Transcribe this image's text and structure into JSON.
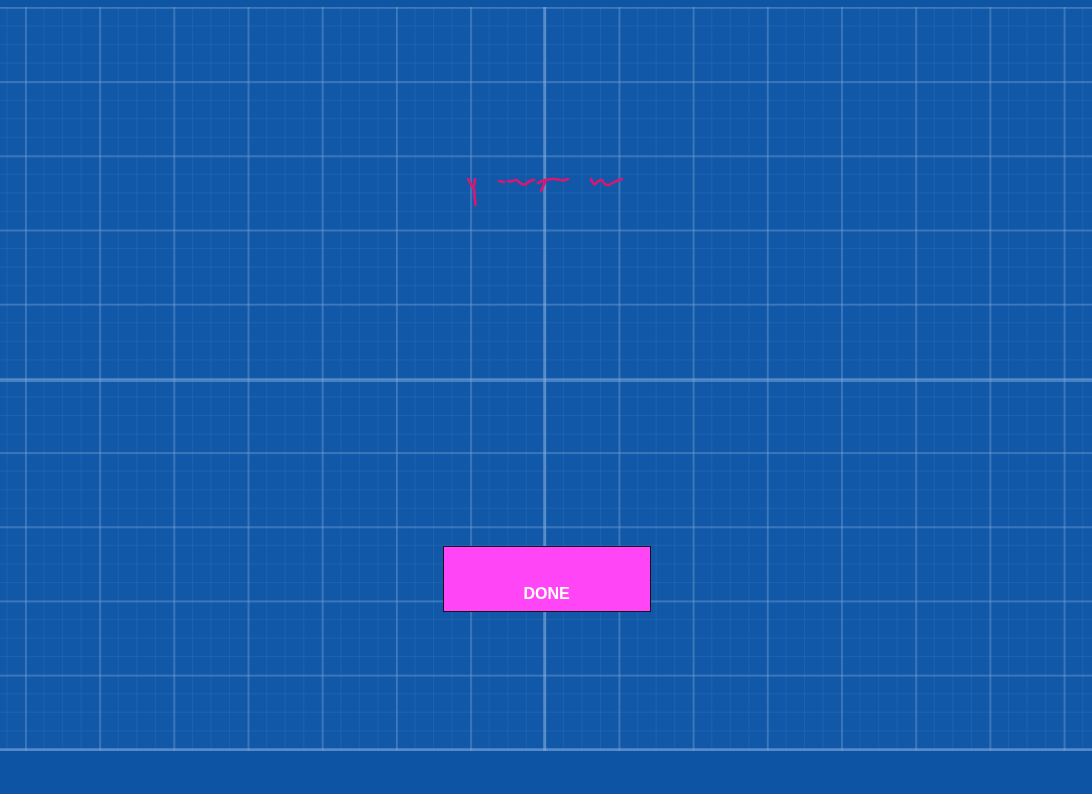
{
  "done_button": {
    "label": "DONE"
  }
}
